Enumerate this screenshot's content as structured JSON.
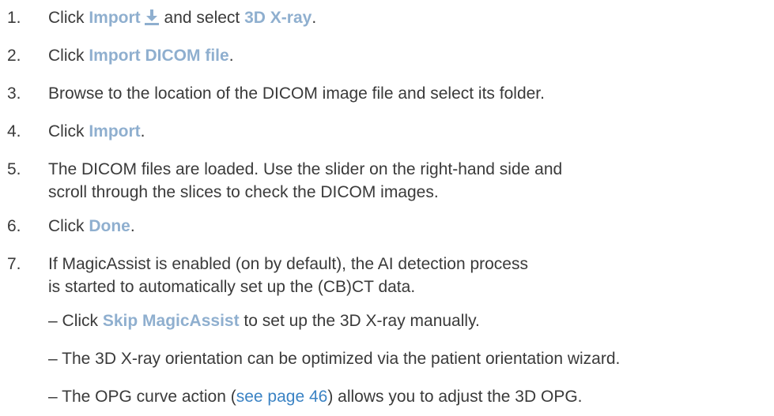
{
  "steps": [
    {
      "num": "1.",
      "pre": "Click ",
      "ui1": "Import",
      "mid": "and select ",
      "ui2": "3D X-ray",
      "post": "."
    },
    {
      "num": "2.",
      "pre": "Click ",
      "ui1": "Import DICOM file",
      "post": "."
    },
    {
      "num": "3.",
      "text": "Browse to the location of the DICOM image file and select its folder."
    },
    {
      "num": "4.",
      "pre": "Click ",
      "ui1": "Import",
      "post": "."
    },
    {
      "num": "5.",
      "line1": "The DICOM files are loaded. Use the slider on the right-hand side and",
      "line2": "scroll through the slices to check the DICOM images."
    },
    {
      "num": "6.",
      "pre": "Click ",
      "ui1": "Done",
      "post": "."
    },
    {
      "num": "7.",
      "line1": "If MagicAssist is enabled (on by default), the AI detection process",
      "line2": "is started to automatically set up the (CB)CT data."
    }
  ],
  "subitems": [
    {
      "dash": "–",
      "pre": " Click ",
      "ui1": "Skip MagicAssist",
      "post": " to set up the 3D X-ray manually."
    },
    {
      "dash": "–",
      "text": " The 3D X-ray orientation can be optimized via the patient orientation wizard."
    },
    {
      "dash": "–",
      "pre": " The OPG curve action (",
      "link": "see page 46",
      "post": ") allows you to adjust the 3D OPG."
    }
  ],
  "icons": {
    "import": "download-icon"
  },
  "colors": {
    "text": "#3a3a3a",
    "ui": "#8fafcf",
    "link": "#3b83c4"
  }
}
